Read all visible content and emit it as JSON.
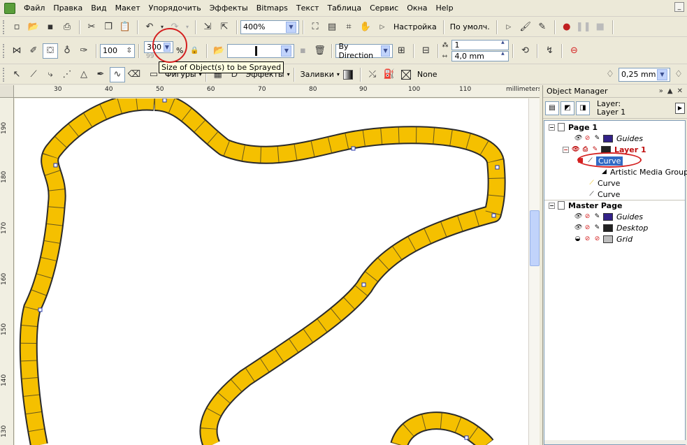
{
  "menu": [
    "Файл",
    "Правка",
    "Вид",
    "Макет",
    "Упорядочить",
    "Эффекты",
    "Bitmaps",
    "Текст",
    "Таблица",
    "Сервис",
    "Окна",
    "Help"
  ],
  "toolbar1": {
    "zoom": "400%",
    "settings_label": "Настройка",
    "default_label": "По умолч."
  },
  "toolbar2": {
    "size_value": "100",
    "spray_size_value": "300",
    "spray_size_secondary": "99",
    "percent_sign": "%",
    "direction_value": "By Direction",
    "count_value": "1",
    "spacing_value": "4,0 mm"
  },
  "tooltip": "Size of Object(s) to be Sprayed",
  "toolbar3": {
    "shapes_label": "Фигуры",
    "effects_label": "Эффекты",
    "fills_label": "Заливки",
    "fill_none_label": "None",
    "outline_width": "0,25 mm"
  },
  "ruler": {
    "units": "millimeters",
    "top_labels": [
      "30",
      "40",
      "50",
      "60",
      "70",
      "80",
      "90",
      "100",
      "110"
    ],
    "left_labels": [
      "190",
      "180",
      "170",
      "160",
      "150",
      "140",
      "130"
    ]
  },
  "object_manager": {
    "title": "Object Manager",
    "layer_prefix": "Layer:",
    "current_layer": "Layer 1",
    "page1": "Page 1",
    "guides": "Guides",
    "layer1": "Layer 1",
    "curve_selected": "Curve",
    "artistic_group": "Artistic Media Group",
    "curve2": "Curve",
    "curve3": "Curve",
    "master_page": "Master Page",
    "master_guides": "Guides",
    "desktop": "Desktop",
    "grid": "Grid"
  },
  "colors": {
    "stroke_fill": "#f5c000",
    "stroke_outline": "#2b2b2b",
    "guides_swatch": "#332288",
    "layer_swatch": "#222222",
    "desktop_swatch": "#222222",
    "grid_swatch": "#bdbdbd",
    "selection": "#316ac5",
    "annotation_red": "#d42020"
  }
}
